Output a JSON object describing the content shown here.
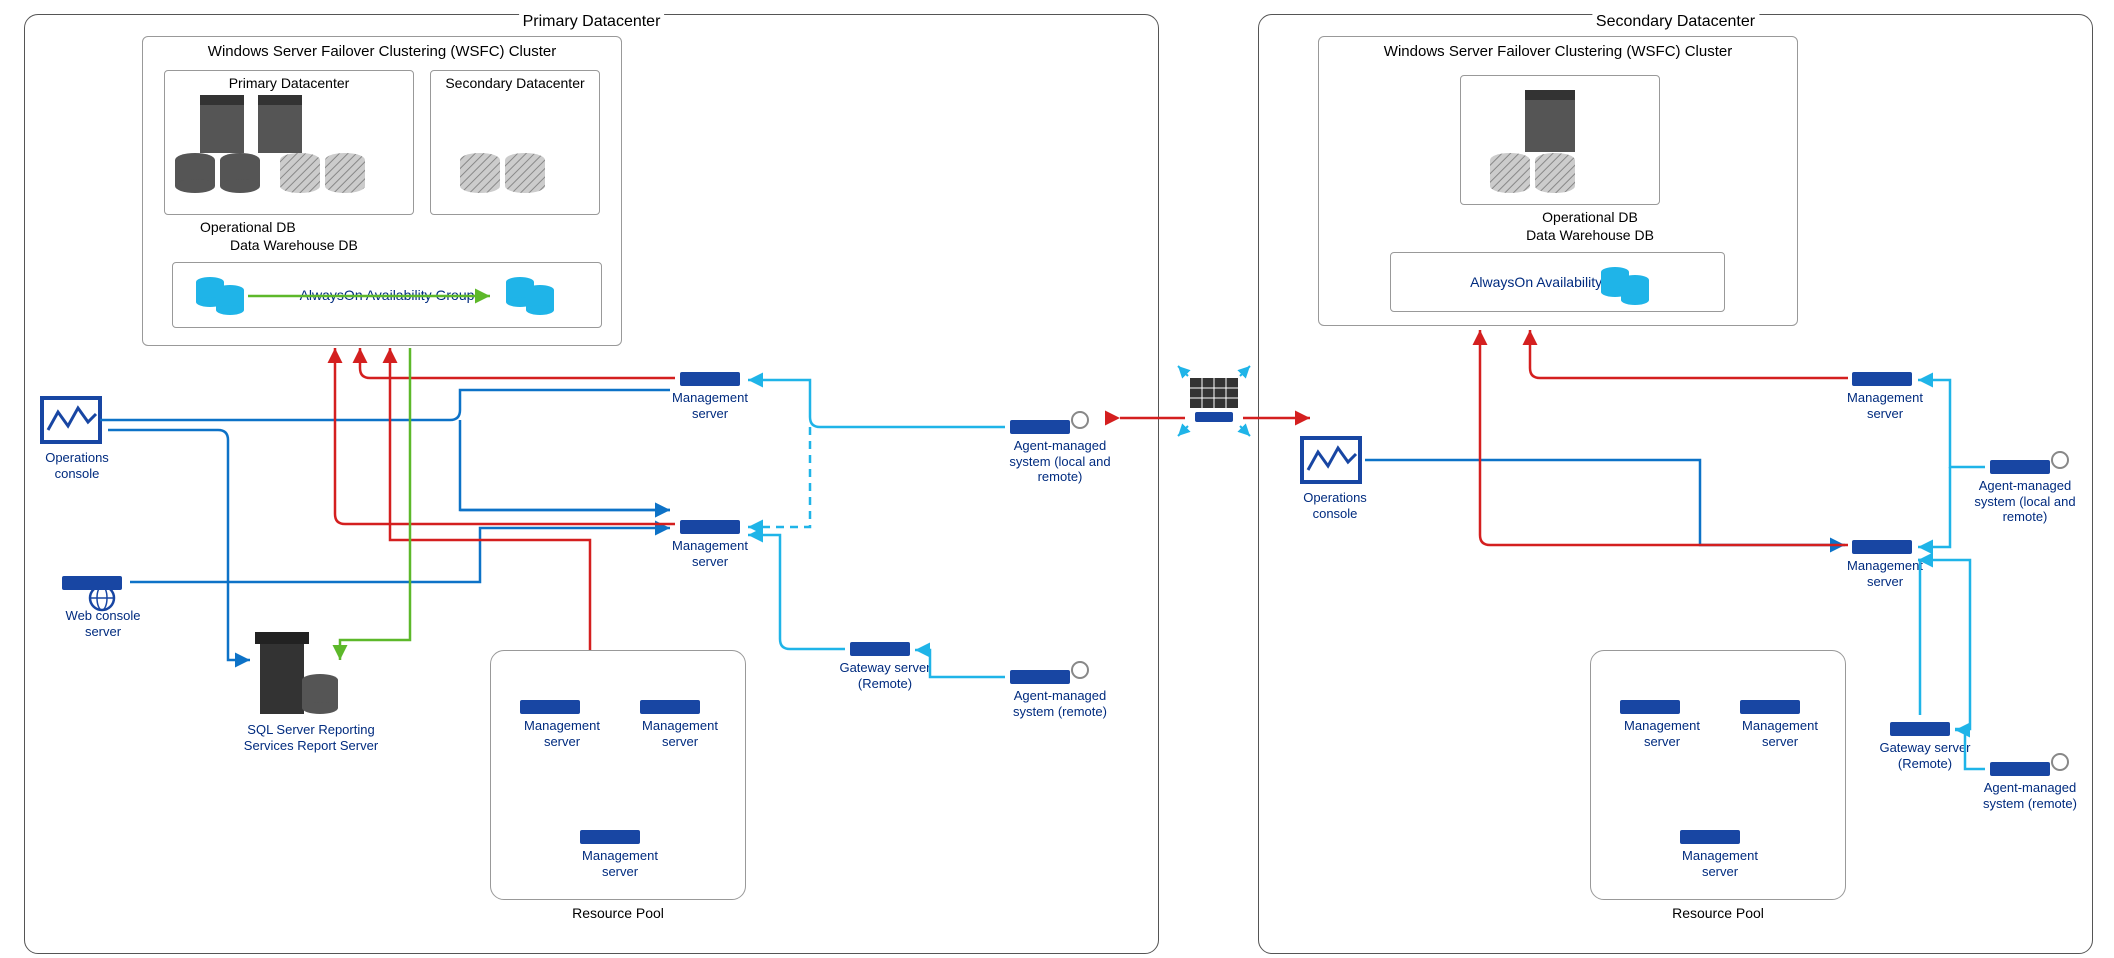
{
  "primary": {
    "title": "Primary Datacenter",
    "wsfc_title": "Windows Server Failover Clustering (WSFC) Cluster",
    "sub_primary": "Primary Datacenter",
    "sub_secondary": "Secondary Datacenter",
    "op_db": "Operational DB",
    "dw_db": "Data Warehouse DB",
    "ag_label": "AlwaysOn Availability Group",
    "ops_console": "Operations console",
    "web_console": "Web console server",
    "sql_report": "SQL Server Reporting Services Report Server",
    "mgmt_server": "Management server",
    "agent_local": "Agent-managed system (local and remote)",
    "gateway": "Gateway server (Remote)",
    "agent_remote": "Agent-managed system (remote)",
    "resource_pool": "Resource Pool"
  },
  "secondary": {
    "title": "Secondary Datacenter",
    "wsfc_title": "Windows Server Failover Clustering (WSFC) Cluster",
    "op_db": "Operational DB",
    "dw_db": "Data Warehouse DB",
    "ag_label": "AlwaysOn Availability Group",
    "ops_console": "Operations console",
    "mgmt_server": "Management server",
    "agent_local": "Agent-managed system (local and remote)",
    "gateway": "Gateway server (Remote)",
    "agent_remote": "Agent-managed system (remote)",
    "resource_pool": "Resource Pool"
  },
  "colors": {
    "blue_dark": "#1846a3",
    "blue_med": "#0d72c7",
    "cyan": "#1fb4e8",
    "red": "#d41f1f",
    "green": "#5db82a",
    "grey": "#555"
  }
}
